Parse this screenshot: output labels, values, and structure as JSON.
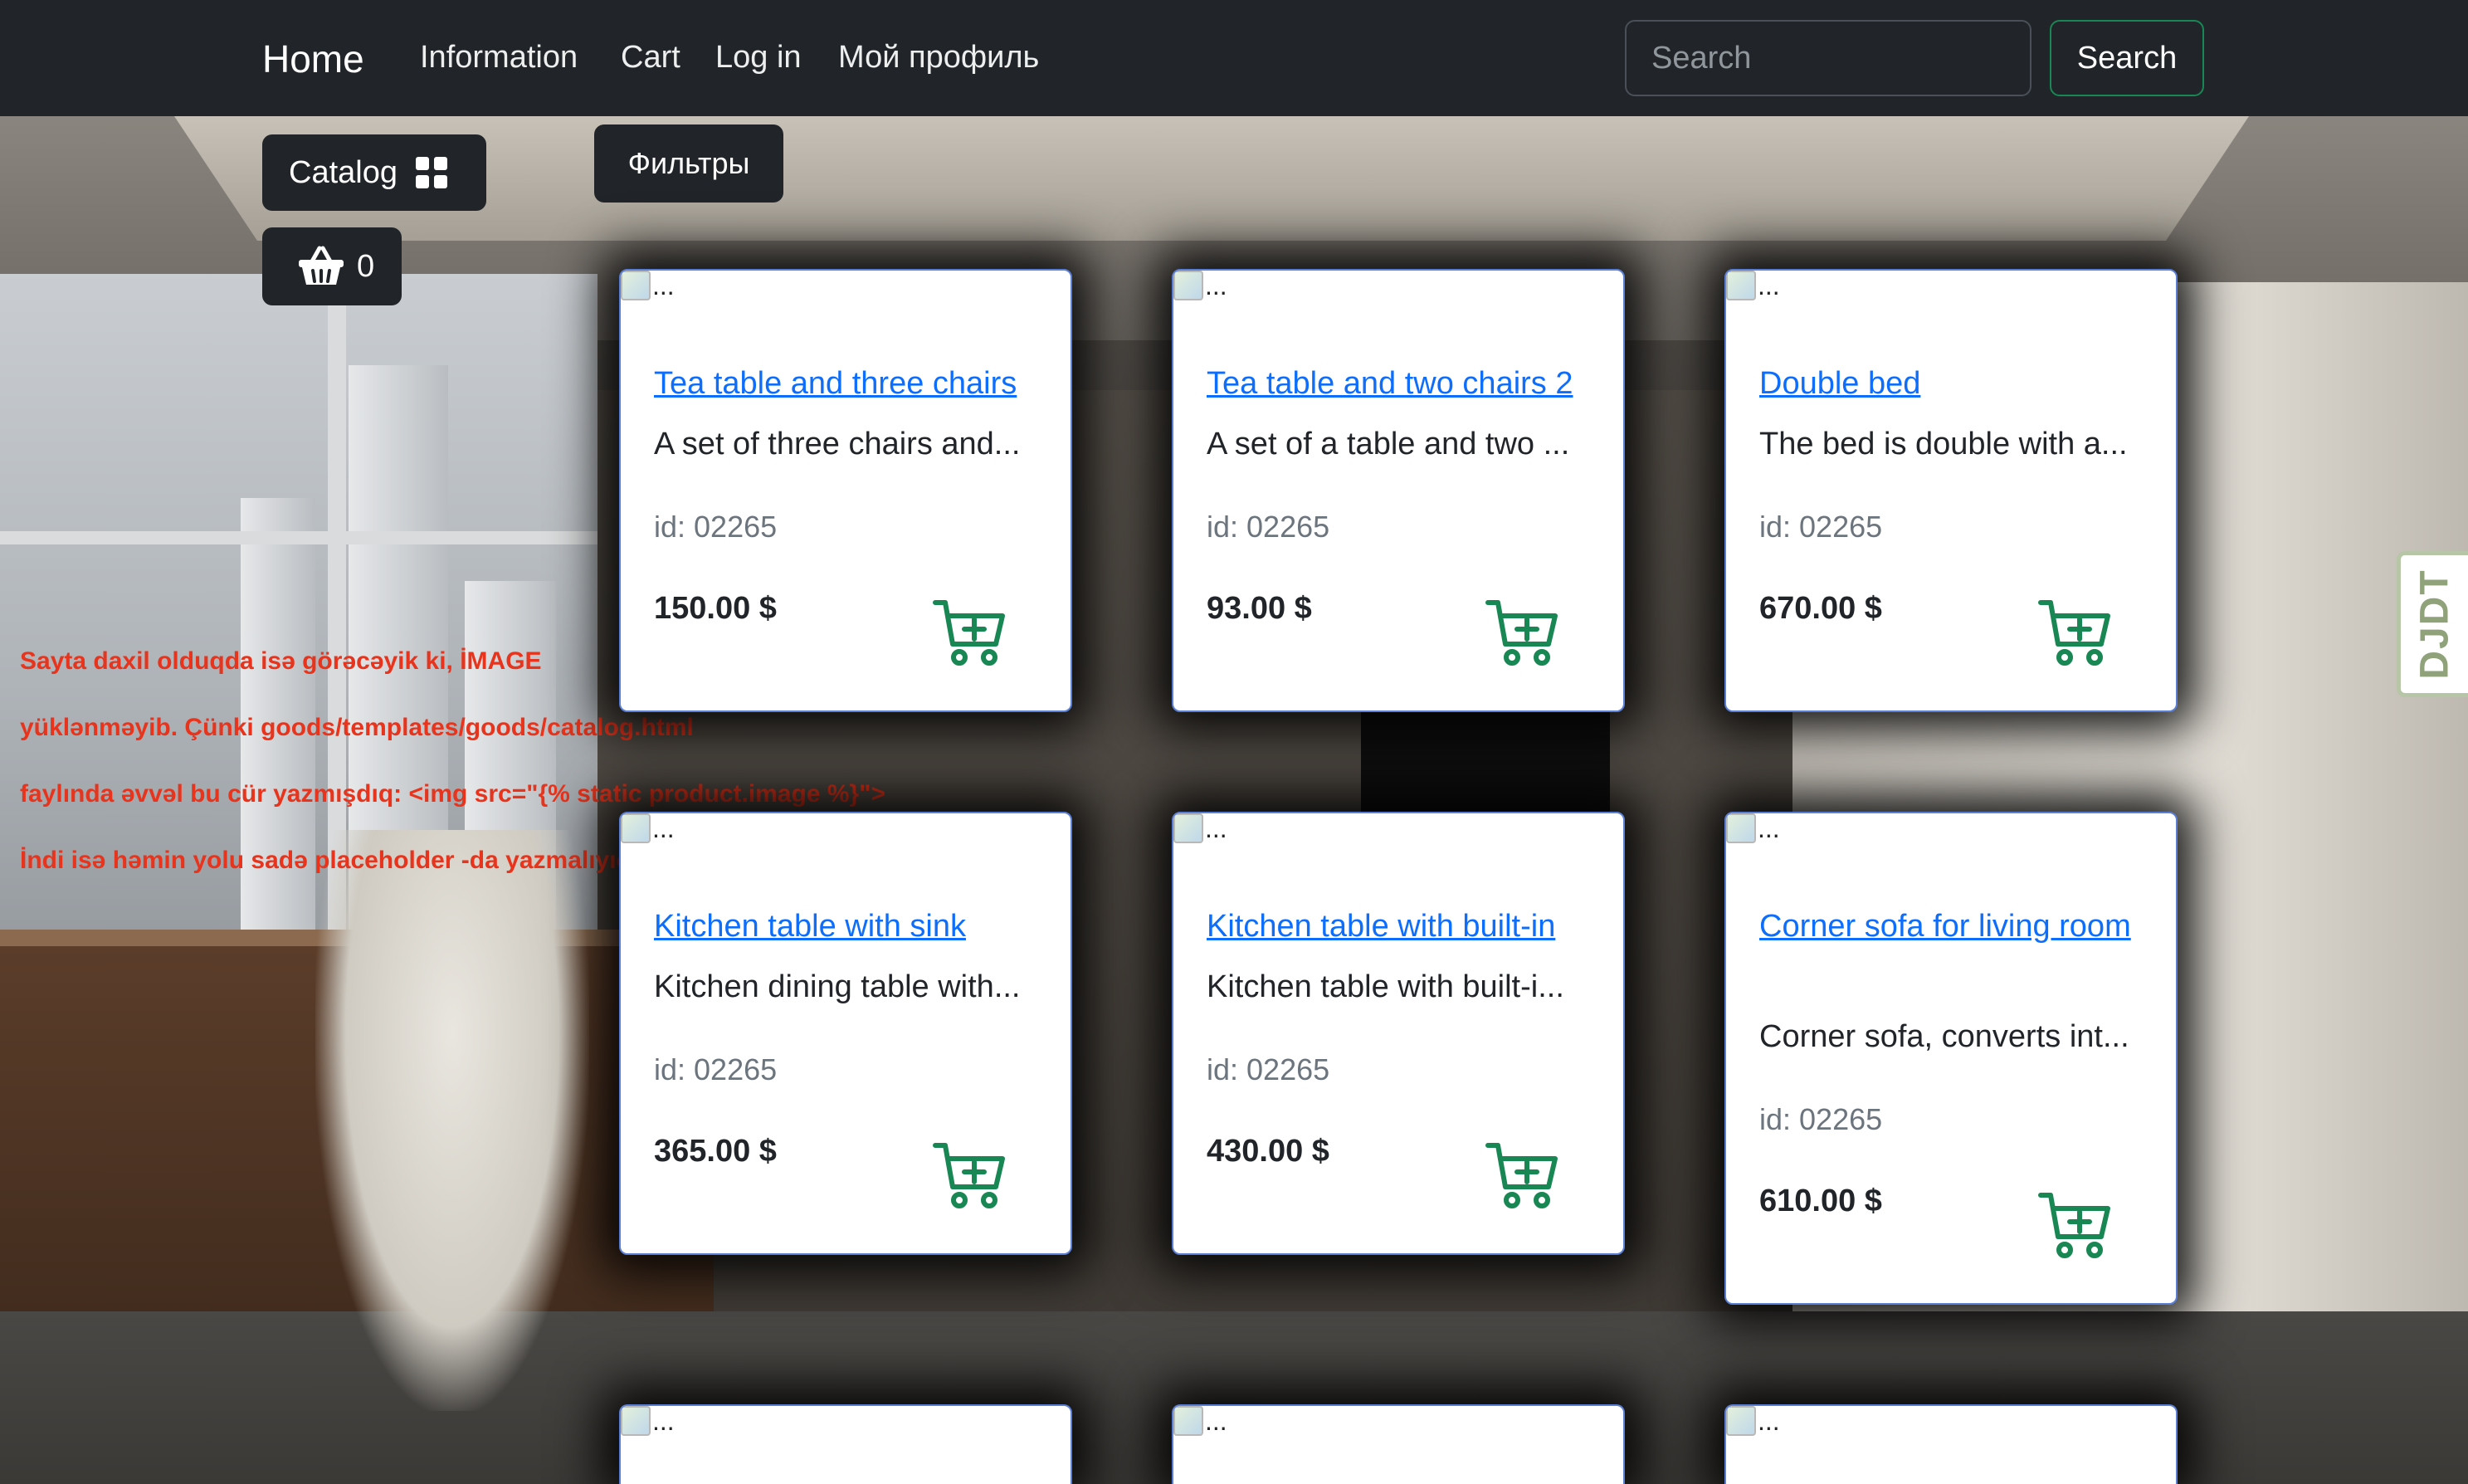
{
  "navbar": {
    "brand": "Home",
    "links": [
      "Information",
      "Cart",
      "Log in",
      "Мой профиль"
    ],
    "search_placeholder": "Search",
    "search_button": "Search"
  },
  "sidebar": {
    "catalog_label": "Catalog",
    "basket_count": "0",
    "filters_label": "Фильтры"
  },
  "debug_note": {
    "lines": [
      "Sayta daxil olduqda isə görəcəyik ki, İMAGE",
      "yüklənməyib. Çünki goods/templates/goods/catalog.html",
      "faylında əvvəl bu cür yazmışdıq: <img src=\"{% static product.image %}\">",
      "İndi isə həmin yolu sadə placeholder -da yazmalıyıq. {{ }}"
    ]
  },
  "products": [
    {
      "alt": "...",
      "title": "Tea table and three chairs",
      "desc": "A set of three chairs and...",
      "id": "id: 02265",
      "price": "150.00 $"
    },
    {
      "alt": "...",
      "title": "Tea table and two chairs 2",
      "desc": "A set of a table and two ...",
      "id": "id: 02265",
      "price": "93.00 $"
    },
    {
      "alt": "...",
      "title": "Double bed",
      "desc": "The bed is double with a...",
      "id": "id: 02265",
      "price": "670.00 $"
    },
    {
      "alt": "...",
      "title": "Kitchen table with sink",
      "desc": "Kitchen dining table with...",
      "id": "id: 02265",
      "price": "365.00 $"
    },
    {
      "alt": "...",
      "title": "Kitchen table with built-in",
      "desc": "Kitchen table with built-i...",
      "id": "id: 02265",
      "price": "430.00 $"
    },
    {
      "alt": "...",
      "title": "Corner sofa for living room",
      "desc": "Corner sofa, converts int...",
      "id": "id: 02265",
      "price": "610.00 $"
    },
    {
      "alt": "..."
    },
    {
      "alt": "..."
    },
    {
      "alt": "..."
    }
  ],
  "debug_toolbar": {
    "label": "DJDT"
  },
  "colors": {
    "navbar": "#212529",
    "link": "#0d6efd",
    "cart_icon": "#198754",
    "note": "#e8341c",
    "card_border": "#5a7fd6"
  },
  "icons": [
    "grid-icon",
    "basket-icon",
    "cart-add-icon",
    "broken-image-icon"
  ]
}
